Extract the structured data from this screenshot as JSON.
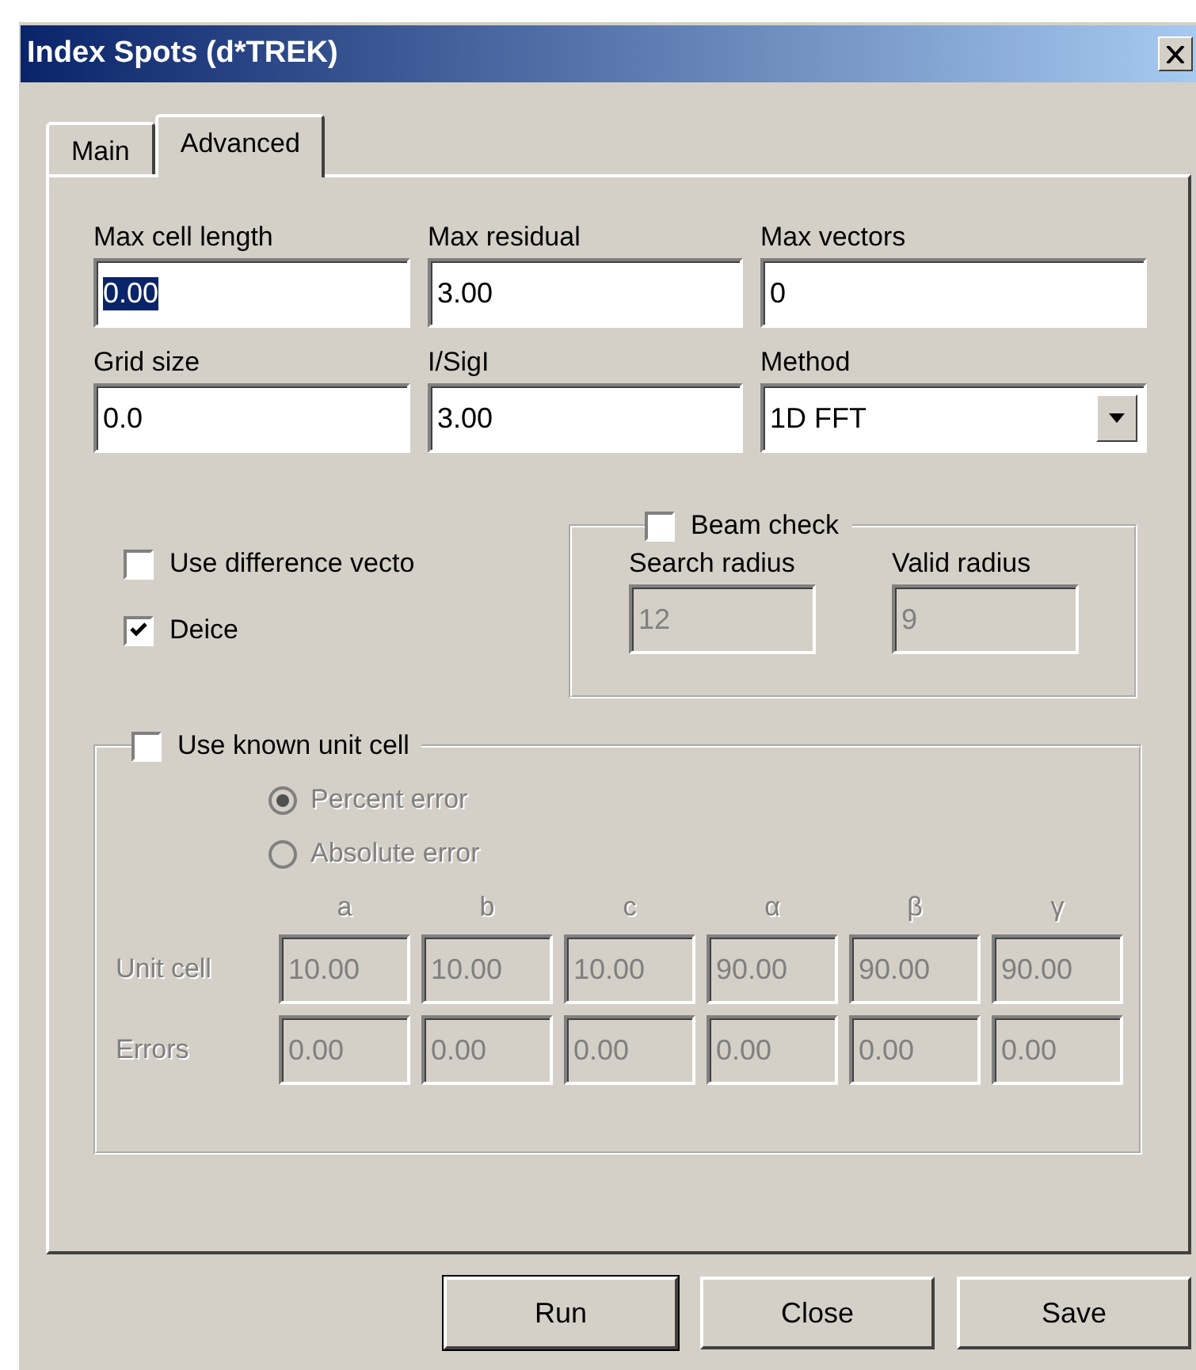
{
  "window": {
    "title": "Index Spots (d*TREK)"
  },
  "tabs": [
    {
      "label": "Main",
      "selected": false
    },
    {
      "label": "Advanced",
      "selected": true
    }
  ],
  "fields": [
    {
      "label": "Max cell length",
      "value": "0.00",
      "kind": "text",
      "text_selected": true
    },
    {
      "label": "Max residual",
      "value": "3.00",
      "kind": "text",
      "text_selected": false
    },
    {
      "label": "Max vectors",
      "value": "0",
      "kind": "text",
      "text_selected": false
    },
    {
      "label": "Grid size",
      "value": "0.0",
      "kind": "text",
      "text_selected": false
    },
    {
      "label": "I/SigI",
      "value": "3.00",
      "kind": "text",
      "text_selected": false
    },
    {
      "label": "Method",
      "value": "1D FFT",
      "kind": "dropdown"
    }
  ],
  "options": [
    {
      "label": "Use difference vecto",
      "checked": false
    },
    {
      "label": "Deice",
      "checked": true
    }
  ],
  "beam_check": {
    "label": "Beam check",
    "checked": false,
    "disabled": true,
    "fields": [
      {
        "label": "Search radius",
        "value": "12"
      },
      {
        "label": "Valid radius",
        "value": "9"
      }
    ]
  },
  "known_cell": {
    "label": "Use known unit cell",
    "checked": false,
    "disabled": true,
    "error_modes": [
      {
        "label": "Percent error",
        "selected": true
      },
      {
        "label": "Absolute error",
        "selected": false
      }
    ],
    "columns": [
      "a",
      "b",
      "c",
      "α",
      "β",
      "γ"
    ],
    "rows": [
      {
        "label": "Unit cell",
        "values": [
          "10.00",
          "10.00",
          "10.00",
          "90.00",
          "90.00",
          "90.00"
        ]
      },
      {
        "label": "Errors",
        "values": [
          "0.00",
          "0.00",
          "0.00",
          "0.00",
          "0.00",
          "0.00"
        ]
      }
    ]
  },
  "buttons": [
    {
      "label": "Run",
      "default": true
    },
    {
      "label": "Close",
      "default": false
    },
    {
      "label": "Save",
      "default": false
    }
  ]
}
